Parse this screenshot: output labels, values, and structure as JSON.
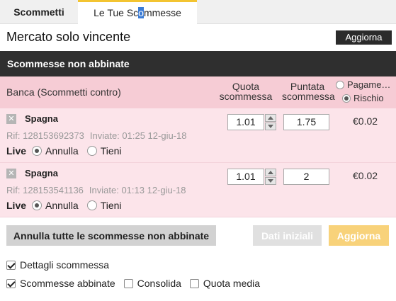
{
  "tabs": {
    "bets": "Scommetti",
    "my_bets_pre": "Le Tue Sc",
    "my_bets_hl": "o",
    "my_bets_post": "mmesse"
  },
  "market": {
    "title": "Mercato solo vincente",
    "refresh_label": "Aggiorna"
  },
  "section": {
    "title": "Scommesse non abbinate"
  },
  "columns": {
    "lay": "Banca (Scommetti contro)",
    "odds_l1": "Quota",
    "odds_l2": "scommessa",
    "stake_l1": "Puntata",
    "stake_l2": "scommessa",
    "payout": "Pagame…",
    "liability": "Rischio",
    "selected_view": "Rischio"
  },
  "bets": [
    {
      "runner": "Spagna",
      "ref": "Rif: 128153692373",
      "placed": "Inviate: 01:25 12-giu-18",
      "live_label": "Live",
      "opt_cancel": "Annulla",
      "opt_keep": "Tieni",
      "selected": "Annulla",
      "odds": "1.01",
      "stake": "1.75",
      "liability": "€0.02"
    },
    {
      "runner": "Spagna",
      "ref": "Rif: 128153541136",
      "placed": "Inviate: 01:13 12-giu-18",
      "live_label": "Live",
      "opt_cancel": "Annulla",
      "opt_keep": "Tieni",
      "selected": "Annulla",
      "odds": "1.01",
      "stake": "2",
      "liability": "€0.02"
    }
  ],
  "actions": {
    "cancel_all": "Annulla tutte le scommesse non abbinate",
    "initial": "Dati iniziali",
    "update": "Aggiorna"
  },
  "options": {
    "bet_details": "Dettagli scommessa",
    "bet_details_checked": true,
    "matched_bets": "Scommesse abbinate",
    "matched_bets_checked": true,
    "consolidate": "Consolida",
    "consolidate_checked": false,
    "average_odds": "Quota media",
    "average_odds_checked": false
  },
  "colors": {
    "header_dark": "#2f2f2f",
    "lay_header": "#f6ccd5",
    "lay_row": "#fce4ea",
    "tab_accent": "#f3c431",
    "update_button": "#f8d27a"
  }
}
